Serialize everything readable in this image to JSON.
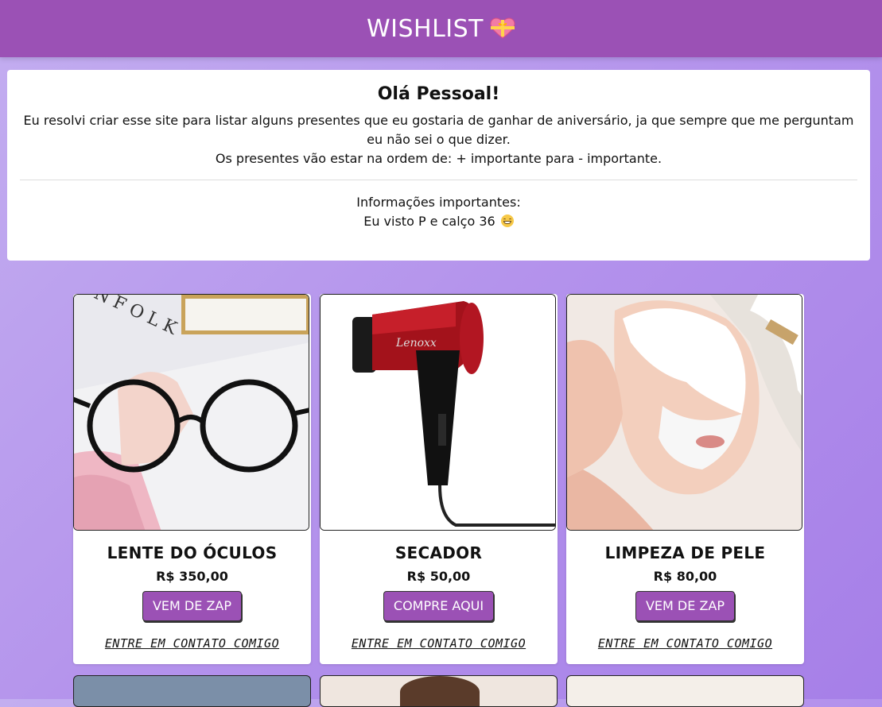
{
  "header": {
    "title": "WISHLIST",
    "icon": "heart-ribbon-icon"
  },
  "intro": {
    "heading": "Olá Pessoal!",
    "line1": "Eu resolvi criar esse site para listar alguns presentes que eu gostaria de ganhar de aniversário, ja que sempre que me perguntam eu não sei o que dizer.",
    "line2": "Os presentes vão estar na ordem de: + importante para - importante.",
    "info_title": "Informações importantes:",
    "info_text": "Eu visto P e calço 36",
    "info_icon": "grinning-face-icon"
  },
  "colors": {
    "header": "#9b51b5",
    "button": "#9b51b5",
    "background": "#b493ec"
  },
  "products": [
    {
      "name": "LENTE DO ÓCULOS",
      "price": "R$ 350,00",
      "button": "VEM DE ZAP",
      "contact": "ENTRE EM CONTATO COMIGO",
      "image": "glasses-photo"
    },
    {
      "name": "SECADOR",
      "price": "R$ 50,00",
      "button": "COMPRE AQUI",
      "contact": "ENTRE EM CONTATO COMIGO",
      "image": "hair-dryer-photo"
    },
    {
      "name": "LIMPEZA DE PELE",
      "price": "R$ 80,00",
      "button": "VEM DE ZAP",
      "contact": "ENTRE EM CONTATO COMIGO",
      "image": "facial-mask-photo"
    }
  ]
}
